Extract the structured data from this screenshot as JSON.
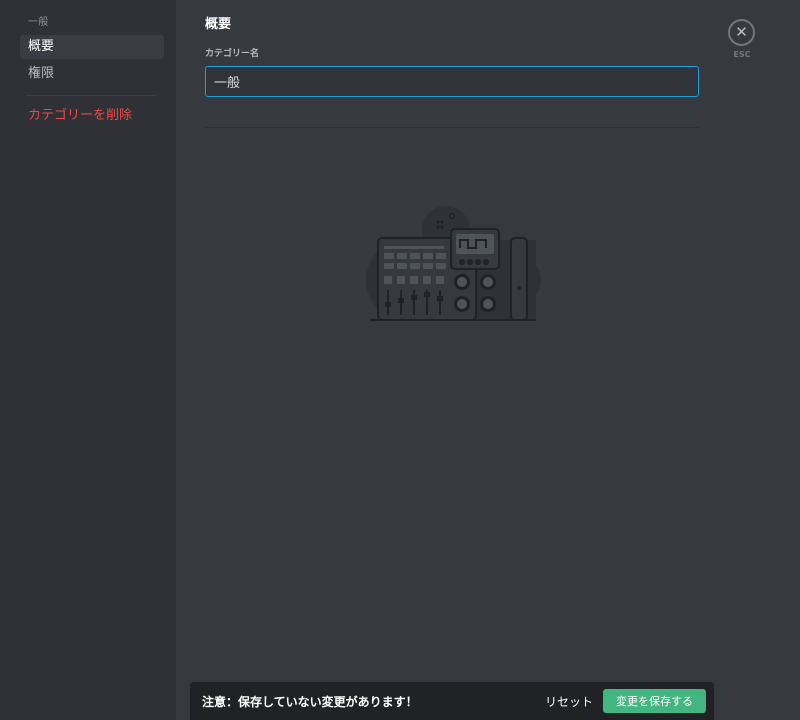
{
  "sidebar": {
    "header": "一般",
    "items": [
      {
        "label": "概要"
      },
      {
        "label": "権限"
      }
    ],
    "delete_label": "カテゴリーを削除"
  },
  "main": {
    "title": "概要",
    "field_label": "カテゴリー名",
    "category_name": "一般"
  },
  "close": {
    "icon": "close-icon",
    "label": "ESC"
  },
  "notice": {
    "text": "注意：保存していない変更があります！",
    "reset_label": "リセット",
    "save_label": "変更を保存する"
  },
  "colors": {
    "background": "#36393f",
    "sidebar": "#2f3136",
    "danger": "#f04747",
    "accent_input": "#1f9ed8",
    "save": "#43b581"
  }
}
